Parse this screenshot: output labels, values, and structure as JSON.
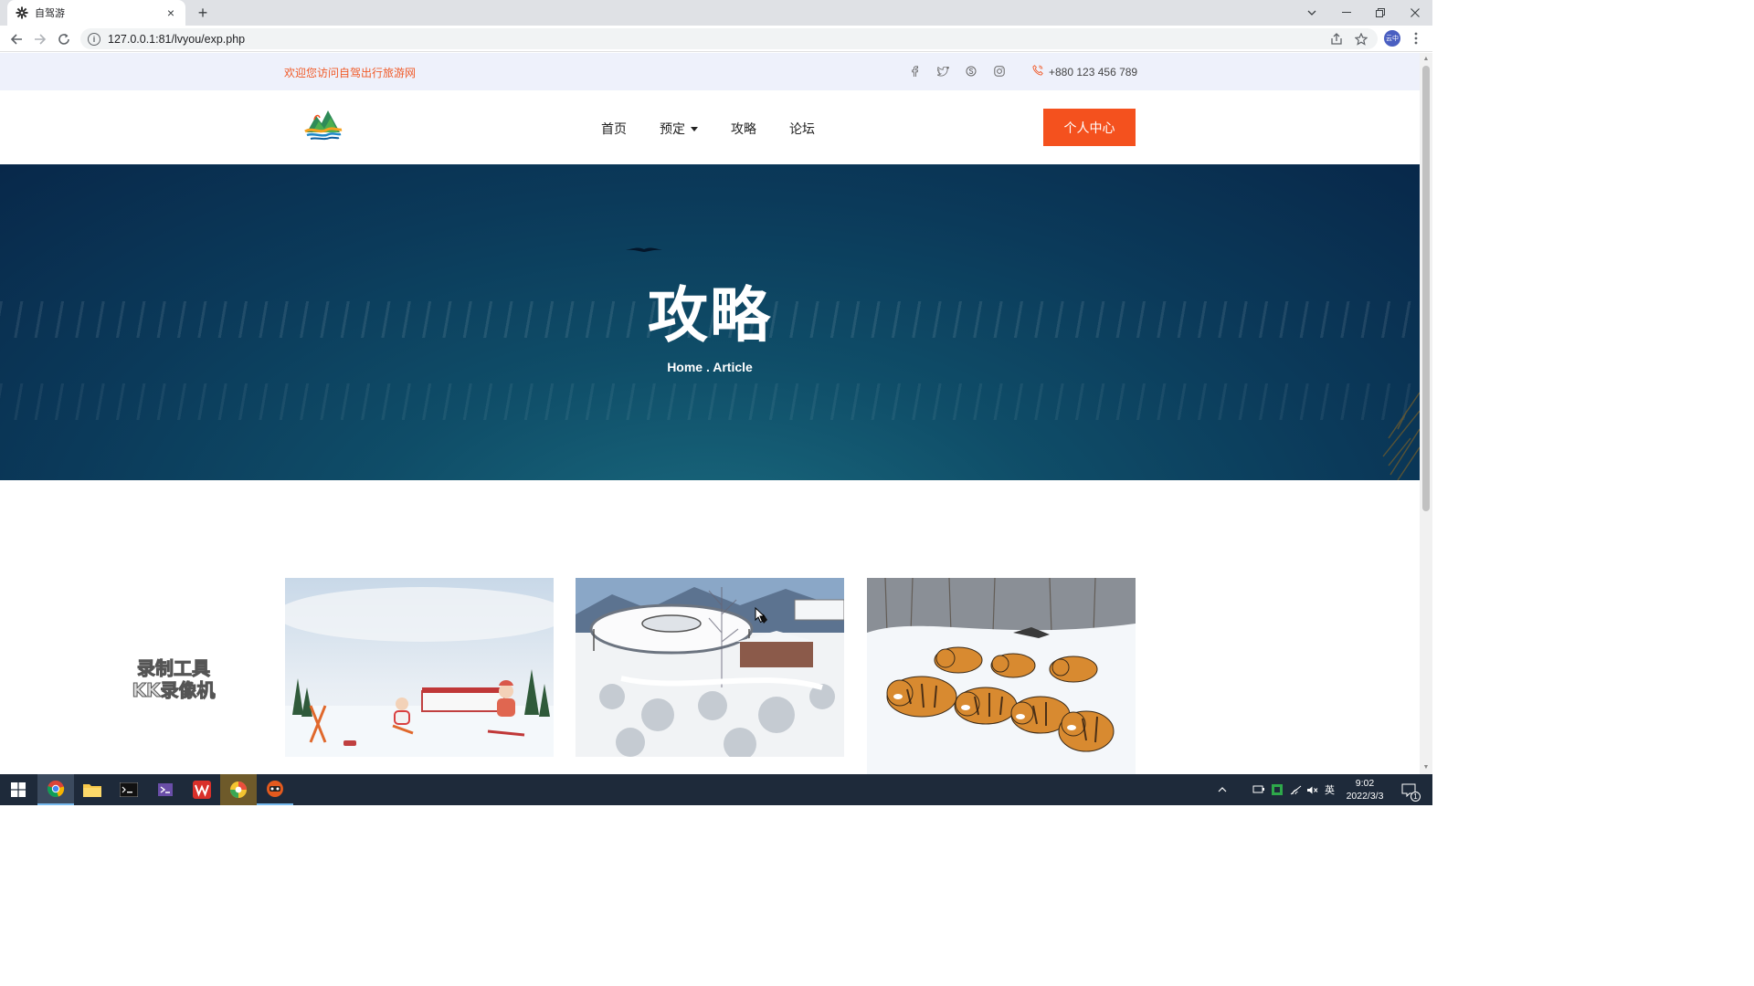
{
  "browser": {
    "tab_title": "自驾游",
    "tab_close": "×",
    "new_tab": "+",
    "url": "127.0.0.1:81/lvyou/exp.php",
    "profile_label": "云中"
  },
  "topbar": {
    "welcome": "欢迎您访问自驾出行旅游网",
    "phone": "+880 123 456 789",
    "socials": [
      "facebook-icon",
      "twitter-icon",
      "skype-icon",
      "instagram-icon"
    ]
  },
  "nav": {
    "items": [
      {
        "label": "首页"
      },
      {
        "label": "预定",
        "has_dropdown": true
      },
      {
        "label": "攻略"
      },
      {
        "label": "论坛"
      }
    ],
    "personal_center": "个人中心"
  },
  "hero": {
    "title": "攻略",
    "breadcrumb": "Home . Article"
  },
  "cards": [
    {
      "image": "ski-cartoon"
    },
    {
      "image": "snowy-observation-platform"
    },
    {
      "image": "tigers-in-snow"
    }
  ],
  "watermark": {
    "line1": "录制工具",
    "line2": "KK录像机"
  },
  "taskbar": {
    "apps": [
      "start-icon",
      "chrome-icon",
      "file-explorer-icon",
      "terminal-icon",
      "visual-studio-icon",
      "wps-icon",
      "app-circle-icon",
      "recorder-icon"
    ],
    "ime": "英",
    "time": "9:02",
    "date": "2022/3/3",
    "notification_count": "1"
  },
  "colors": {
    "accent": "#f4511e",
    "welcome_text": "#f05a28",
    "topbar_bg": "#eef1fb",
    "hero_dark": "#08284a"
  }
}
